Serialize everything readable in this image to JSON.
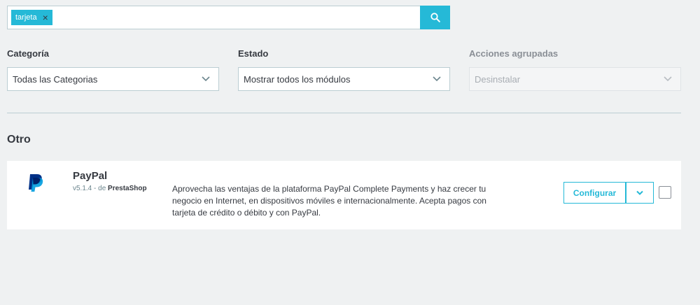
{
  "search": {
    "tag_label": "tarjeta",
    "tag_close": "×",
    "placeholder": ""
  },
  "filters": {
    "category": {
      "label": "Categoría",
      "selected": "Todas las Categorias"
    },
    "status": {
      "label": "Estado",
      "selected": "Mostrar todos los módulos"
    },
    "bulk": {
      "label": "Acciones agrupadas",
      "selected": "Desinstalar"
    }
  },
  "section": {
    "title": "Otro"
  },
  "module": {
    "name": "PayPal",
    "version": "v5.1.4",
    "by_prefix": " - de ",
    "author": "PrestaShop",
    "description": "Aprovecha las ventajas de la plataforma PayPal Complete Payments y haz crecer tu negocio en Internet, en dispositivos móviles e internacionalmente. Acepta pagos con tarjeta de crédito o débito y con PayPal.",
    "configure_label": "Configurar"
  },
  "colors": {
    "accent": "#25b9d7",
    "background": "#eff1f2",
    "paypal_dark": "#003087",
    "paypal_light": "#009cde"
  },
  "icons": {
    "search": "search-icon",
    "close": "close-icon",
    "chevron": "chevron-down-icon",
    "logo": "paypal-logo-icon"
  }
}
